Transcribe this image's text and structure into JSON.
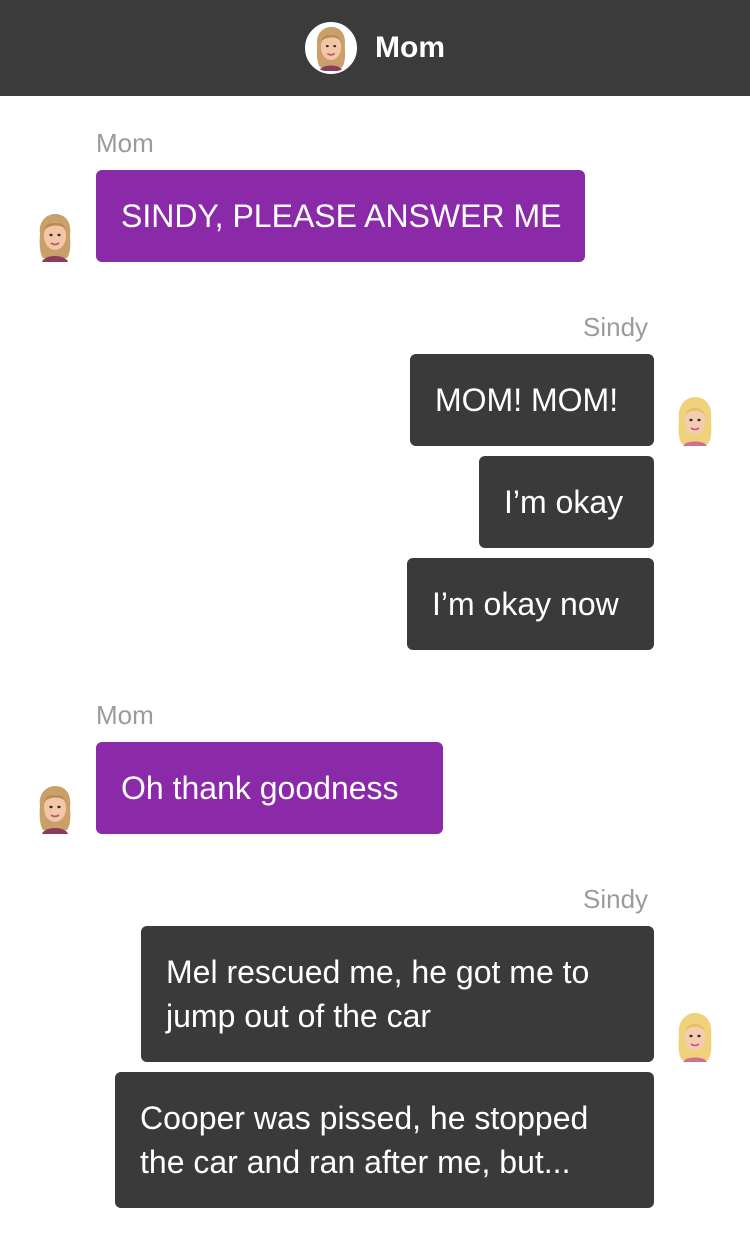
{
  "header": {
    "title": "Mom",
    "avatar_icon": "mom-avatar-icon",
    "background": "#3b3b3b"
  },
  "colors": {
    "mom_bubble": "#8a2aa8",
    "sindy_bubble": "#3a3a3a",
    "sender_label": "#9b9b9b"
  },
  "messages": {
    "group1": {
      "sender": "Mom",
      "lines": [
        "SINDY, PLEASE ANSWER ME"
      ]
    },
    "group2": {
      "sender": "Sindy",
      "lines": [
        "MOM! MOM!",
        "I’m okay",
        "I’m okay now"
      ]
    },
    "group3": {
      "sender": "Mom",
      "lines": [
        "Oh thank goodness"
      ]
    },
    "group4": {
      "sender": "Sindy",
      "lines": [
        [
          "Mel rescued me, he got me to",
          "jump out of the car"
        ],
        [
          "Cooper was pissed, he stopped",
          "the car and ran after me, but..."
        ]
      ]
    }
  }
}
